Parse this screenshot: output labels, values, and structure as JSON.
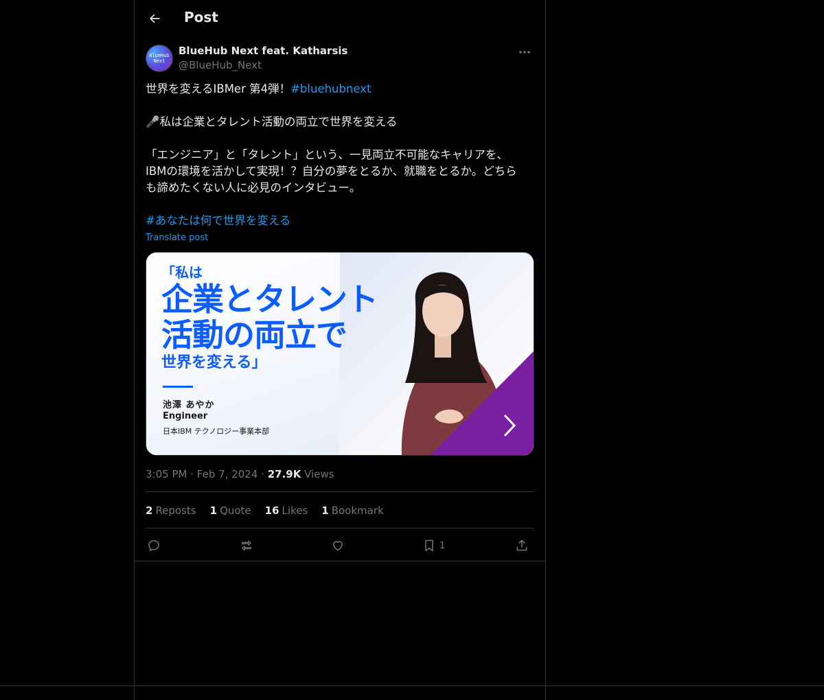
{
  "header": {
    "title": "Post"
  },
  "author": {
    "name": "BlueHub Next feat. Katharsis",
    "handle": "@BlueHub_Next",
    "avatar_line1": "BlueHub",
    "avatar_line2": "Next"
  },
  "tweet": {
    "line1_text": "世界を変えるIBMer 第4弾！",
    "line1_hashtag": "#bluehubnext",
    "line2": "🎤私は企業とタレント活動の両立で世界を変える",
    "line3": "「エンジニア」と「タレント」という、一見両立不可能なキャリアを、",
    "line4": "IBMの環境を活かして実現！？自分の夢をとるか、就職をとるか。どちら",
    "line5": "も諦めたくない人に必見のインタビュー。",
    "hashtag2": "#あなたは何で世界を変える",
    "translate": "Translate post"
  },
  "media": {
    "quote_open": "「私は",
    "headline_1": "企業とタレント",
    "headline_2": "活動の両立で",
    "headline_3": "世界を変える」",
    "person_name": "池澤 あやか",
    "person_role": "Engineer",
    "person_dept": "日本IBM テクノロジー事業本部",
    "accent_color": "#7b1fa2",
    "headline_color": "#0d5cff"
  },
  "meta": {
    "time": "3:05 PM",
    "date": "Feb 7, 2024",
    "views_count": "27.9K",
    "views_label": "Views"
  },
  "stats": {
    "reposts_count": "2",
    "reposts_label": "Reposts",
    "quote_count": "1",
    "quote_label": "Quote",
    "likes_count": "16",
    "likes_label": "Likes",
    "bookmark_count": "1",
    "bookmark_label": "Bookmark"
  },
  "actions": {
    "bookmark_count": "1"
  },
  "icons": [
    "back-arrow-icon",
    "more-icon",
    "reply-icon",
    "repost-icon",
    "like-icon",
    "bookmark-icon",
    "share-icon",
    "chevron-right-icon"
  ]
}
